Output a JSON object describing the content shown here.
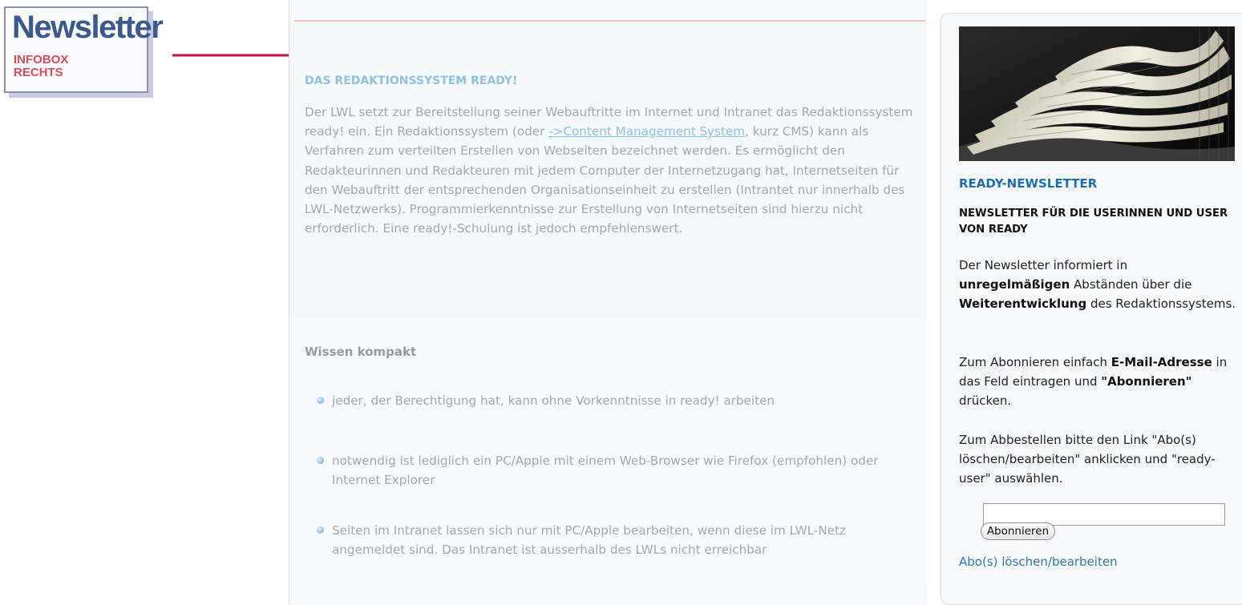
{
  "label_box": {
    "title": "Newsletter",
    "line1": "INFOBOX",
    "line2": "RECHTS"
  },
  "colors": {
    "arrow": "#c0143c",
    "section_title": "#8ec0e2",
    "sidebar_title": "#1a6fb3",
    "link": "#2f78b8"
  },
  "main": {
    "section_title": "DAS REDAKTIONSSYSTEM READY!",
    "intro_before_link": "Der LWL setzt zur Bereitstellung seiner Webauftritte im Internet und Intranet das Redaktionssystem ready! ein. Ein Redaktionssystem (oder ",
    "intro_link": "->Content Management System",
    "intro_after_link": ", kurz CMS) kann als Verfahren zum verteilten Erstellen von Webseiten bezeichnet werden. Es ermöglicht den Redakteurinnen und Redakteuren mit jedem Computer der Internetzugang hat, Internetseiten für den Webauftritt der entsprechenden Organisationseinheit zu erstellen (Intrantet nur innerhalb des LWL-Netzwerks). Programmierkenntnisse zur Erstellung von Internetseiten sind hierzu nicht erforderlich. Eine ready!-Schulung ist jedoch empfehlenswert.",
    "wissen_title": "Wissen kompakt",
    "bullets": [
      "jeder, der Berechtigung hat, kann ohne Vorkenntnisse in ready! arbeiten",
      "notwendig ist lediglich ein PC/Apple mit einem Web-Browser wie Firefox (empfohlen) oder Internet Explorer",
      "Seiten im Intranet lassen sich nur mit PC/Apple bearbeiten, wenn diese im LWL-Netz angemeldet sind. Das Intranet ist ausserhalb des LWLs nicht erreichbar"
    ]
  },
  "sidebar": {
    "title": "READY-NEWSLETTER",
    "subtitle": "NEWSLETTER FÜR DIE USERINNEN UND USER VON READY",
    "p1": {
      "a": "Der Newsletter informiert in ",
      "b": "unregelmäßigen",
      "c": " Abständen über die ",
      "d": "Weiterentwicklung",
      "e": " des Redaktionssystems."
    },
    "p2": {
      "a": "Zum Abonnieren einfach ",
      "b": "E-Mail-Adresse",
      "c": " in das Feld eintragen und ",
      "d": "\"Abonnieren\"",
      "e": " drücken."
    },
    "p3": "Zum Abbestellen bitte den Link \"Abo(s) löschen/bearbeiten\" anklicken und \"ready-user\" auswählen.",
    "email_value": "",
    "subscribe_label": "Abonnieren",
    "manage_link": "Abo(s) löschen/bearbeiten"
  }
}
